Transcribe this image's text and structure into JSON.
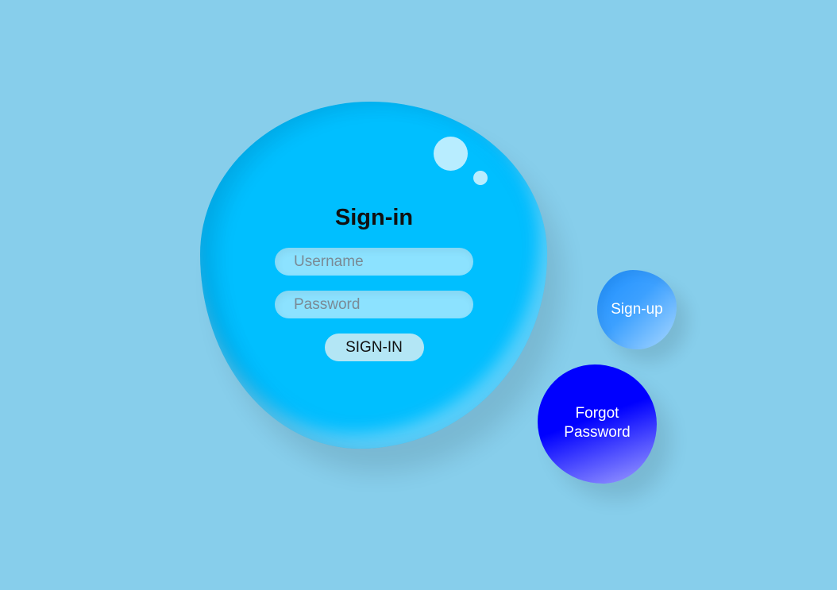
{
  "login": {
    "title": "Sign-in",
    "username_placeholder": "Username",
    "password_placeholder": "Password",
    "submit_label": "SIGN-IN"
  },
  "links": {
    "signup_label": "Sign-up",
    "forgot_label": "Forgot Password"
  },
  "colors": {
    "background": "#87ceeb",
    "main_drop": "#00bfff",
    "signup_drop": "#1e90ff",
    "forgot_drop": "#0000ff"
  }
}
